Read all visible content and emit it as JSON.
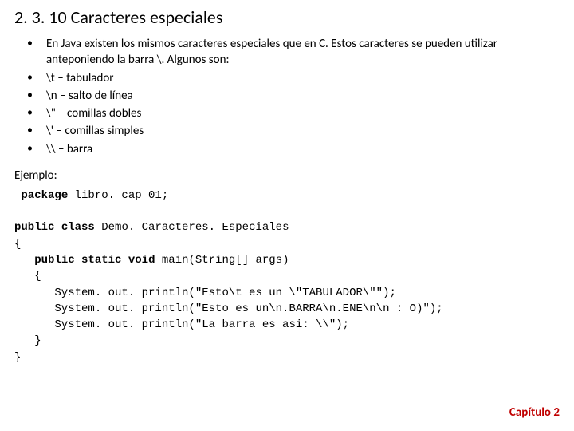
{
  "title": "2. 3. 10 Caracteres especiales",
  "bullets": [
    "En Java existen los mismos caracteres especiales que en C. Estos caracteres se pueden utilizar anteponiendo la barra \\. Algunos son:",
    "\\t – tabulador",
    "\\n – salto de línea",
    "\\\" – comillas dobles",
    "\\' – comillas simples",
    "\\\\ – barra"
  ],
  "example_label": "Ejemplo:",
  "code": {
    "kw_package": "package",
    "pkg_rest": " libro. cap 01;",
    "kw_public1": "public",
    "kw_class": "class",
    "class_rest": " Demo. Caracteres. Especiales",
    "brace_open": "{",
    "indent1": "   ",
    "kw_public2": "public",
    "kw_static": "static",
    "kw_void": "void",
    "main_sig": " main(String[] args)",
    "brace_open2": "   {",
    "line1": "      System. out. println(\"Esto\\t es un \\\"TABULADOR\\\"\");",
    "line2": "      System. out. println(\"Esto es un\\n.BARRA\\n.ENE\\n\\n : O)\");",
    "line3": "      System. out. println(\"La barra es asi: \\\\\");",
    "brace_close2": "   }",
    "brace_close": "}"
  },
  "footer": "Capítulo 2"
}
